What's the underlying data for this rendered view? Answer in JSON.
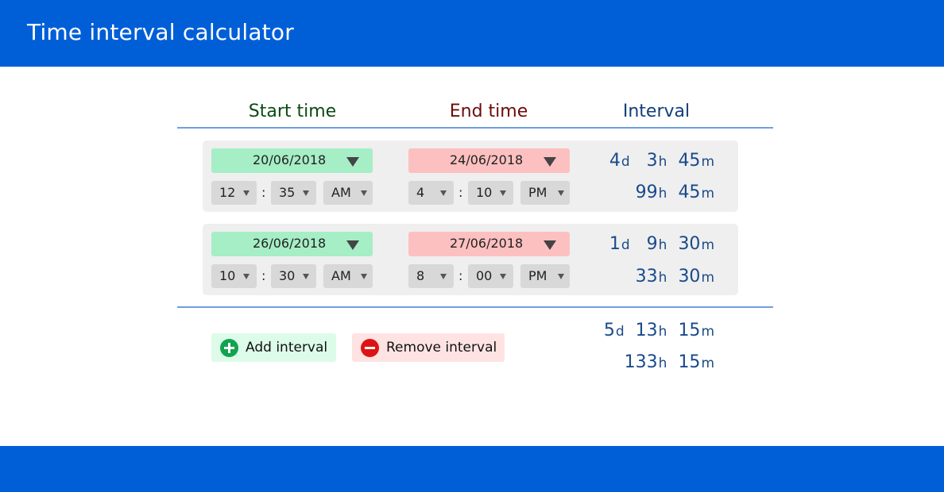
{
  "app": {
    "title": "Time interval calculator"
  },
  "headers": {
    "start": "Start time",
    "end": "End time",
    "interval": "Interval"
  },
  "rows": [
    {
      "start": {
        "date": "20/06/2018",
        "hour": "12",
        "minute": "35",
        "ampm": "AM"
      },
      "end": {
        "date": "24/06/2018",
        "hour": "4",
        "minute": "10",
        "ampm": "PM"
      },
      "interval": {
        "days": "4",
        "hours": "3",
        "minutes": "45",
        "total_hours": "99",
        "total_minutes": "45"
      }
    },
    {
      "start": {
        "date": "26/06/2018",
        "hour": "10",
        "minute": "30",
        "ampm": "AM"
      },
      "end": {
        "date": "27/06/2018",
        "hour": "8",
        "minute": "00",
        "ampm": "PM"
      },
      "interval": {
        "days": "1",
        "hours": "9",
        "minutes": "30",
        "total_hours": "33",
        "total_minutes": "30"
      }
    }
  ],
  "total": {
    "days": "5",
    "hours": "13",
    "minutes": "15",
    "total_hours": "133",
    "total_minutes": "15"
  },
  "units": {
    "d": "d",
    "h": "h",
    "m": "m"
  },
  "colon": ":",
  "actions": {
    "add_label": "Add interval",
    "remove_label": "Remove interval"
  },
  "colors": {
    "brand": "#005fd7",
    "start_accent": "#a6eec5",
    "end_accent": "#fdc0c0",
    "interval_text": "#1a4a8a",
    "add_icon": "#13a350",
    "remove_icon": "#dd1414"
  },
  "icons": {
    "add": "plus-circle-icon",
    "remove": "minus-circle-icon",
    "dropdown": "chevron-down-icon"
  }
}
